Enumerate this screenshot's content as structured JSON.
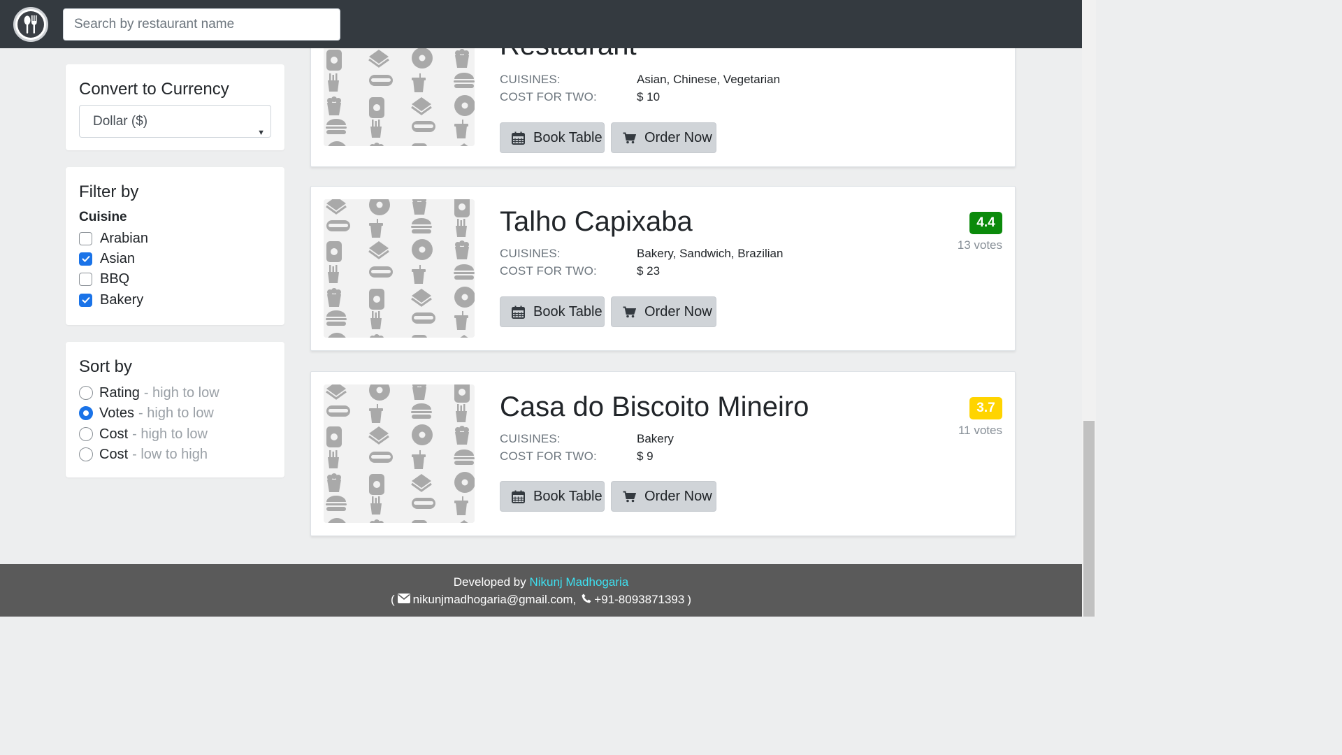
{
  "header": {
    "logo_icon": "cutlery-icon",
    "search": {
      "placeholder": "Search by restaurant name",
      "value": ""
    }
  },
  "sidebar": {
    "currency": {
      "title": "Convert to Currency",
      "selected": "Dollar ($)"
    },
    "filter": {
      "title": "Filter by",
      "subtitle": "Cuisine",
      "options": [
        {
          "label": "Arabian",
          "checked": false
        },
        {
          "label": "Asian",
          "checked": true
        },
        {
          "label": "BBQ",
          "checked": false
        },
        {
          "label": "Bakery",
          "checked": true
        }
      ]
    },
    "sort": {
      "title": "Sort by",
      "options": [
        {
          "label": "Rating",
          "hint": "- high to low",
          "selected": false
        },
        {
          "label": "Votes",
          "hint": "- high to low",
          "selected": true
        },
        {
          "label": "Cost",
          "hint": "- high to low",
          "selected": false
        },
        {
          "label": "Cost",
          "hint": "- low to high",
          "selected": false
        }
      ]
    }
  },
  "labels": {
    "cuisines": "CUISINES:",
    "cost_for_two": "COST FOR TWO:",
    "book_table": "Book Table",
    "order_now": "Order Now"
  },
  "restaurants": [
    {
      "name": "Restaurant",
      "cuisines": "Asian, Chinese, Vegetarian",
      "cost": "$ 10"
    },
    {
      "name": "Talho Capixaba",
      "cuisines": "Bakery, Sandwich, Brazilian",
      "cost": "$ 23",
      "rating": "4.4",
      "rating_color": "#0b8a0b",
      "votes": "13 votes"
    },
    {
      "name": "Casa do Biscoito Mineiro",
      "cuisines": "Bakery",
      "cost": "$ 9",
      "rating": "3.7",
      "rating_color": "#ffd400",
      "votes": "11 votes"
    }
  ],
  "footer": {
    "developed_by": "Developed by",
    "developer_name": "Nikunj Madhogaria",
    "open_paren": "(",
    "email": "nikunjmadhogaria@gmail.com,",
    "phone": "+91-8093871393",
    "close_paren": ")"
  }
}
